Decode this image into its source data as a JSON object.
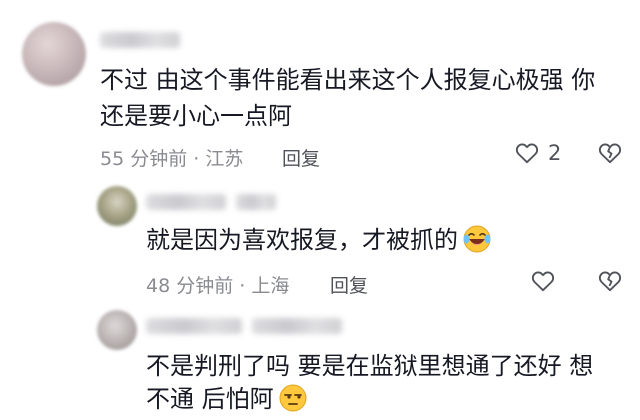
{
  "comments": [
    {
      "text_lines": [
        "不过 由这个事件能看出来这个人报复心极强 你",
        "还是要小心一点阿"
      ],
      "time": "55 分钟前",
      "separator": "·",
      "location": "江苏",
      "reply_label": "回复",
      "like_count": "2"
    },
    {
      "text": "就是因为喜欢报复，才被抓的",
      "emoji": "laugh-cry-emoji",
      "time": "48 分钟前",
      "separator": "·",
      "location": "上海",
      "reply_label": "回复",
      "like_count": ""
    },
    {
      "text_lines": [
        "不是判刑了吗 要是在监狱里想通了还好 想",
        "不通 后怕阿"
      ],
      "emoji": "skeptical-face-emoji"
    }
  ],
  "colors": {
    "text": "#161823",
    "meta": "#8a8b91",
    "icon": "#505259",
    "emoji_yellow": "#ffc83d"
  }
}
